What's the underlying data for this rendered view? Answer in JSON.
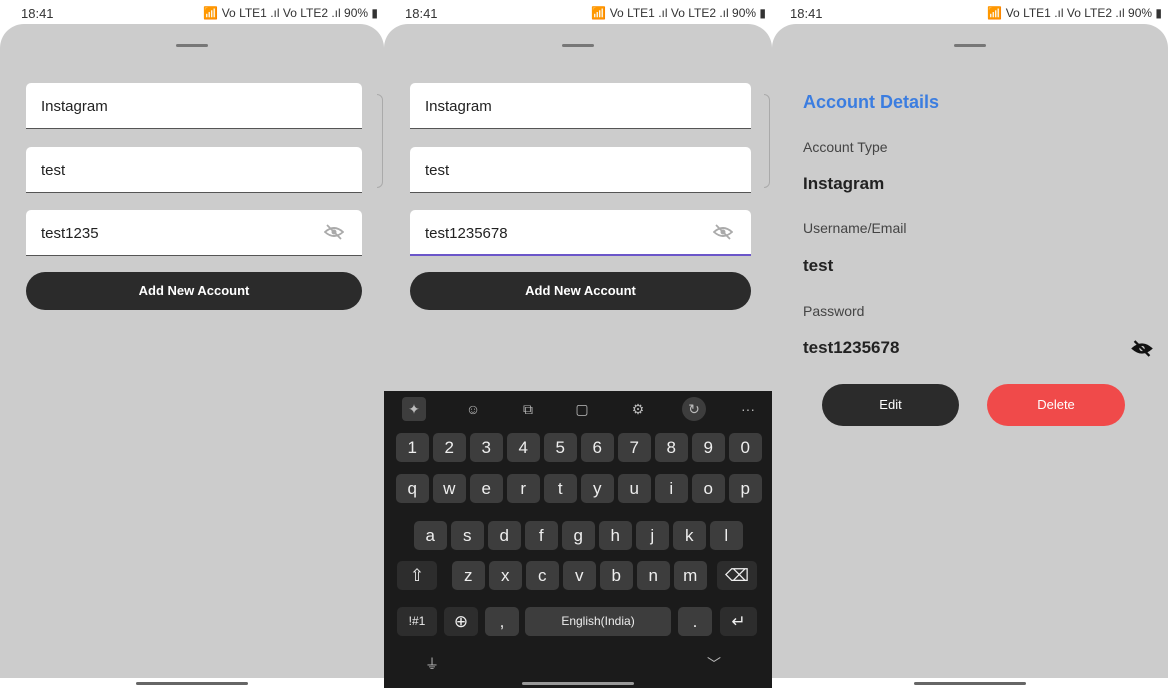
{
  "status": {
    "time": "18:41",
    "battery": "90%",
    "signal": "Vo LTE1 .ıl Vo LTE2 .ıl"
  },
  "screen1": {
    "account_type": "Instagram",
    "username": "test",
    "password": "test1235",
    "add_button": "Add New Account"
  },
  "screen2": {
    "account_type": "Instagram",
    "username": "test",
    "password": "test1235678",
    "add_button": "Add New Account",
    "keyboard": {
      "tools": [
        "sparkle-icon",
        "emoji-icon",
        "translate-icon",
        "clipboard-icon",
        "settings-icon",
        "mode-icon",
        "more-icon"
      ],
      "more": "···",
      "row_numbers": [
        "1",
        "2",
        "3",
        "4",
        "5",
        "6",
        "7",
        "8",
        "9",
        "0"
      ],
      "row1": [
        "q",
        "w",
        "e",
        "r",
        "t",
        "y",
        "u",
        "i",
        "o",
        "p"
      ],
      "row2": [
        "a",
        "s",
        "d",
        "f",
        "g",
        "h",
        "j",
        "k",
        "l"
      ],
      "row3": [
        "z",
        "x",
        "c",
        "v",
        "b",
        "n",
        "m"
      ],
      "shift": "⇧",
      "backspace": "⌫",
      "symbols": "!#1",
      "globe": "⊕",
      "comma": ",",
      "space": "English(India)",
      "period": ".",
      "enter": "↵",
      "mic": "🎙",
      "collapse": "﹀"
    }
  },
  "screen3": {
    "title": "Account Details",
    "account_type_label": "Account Type",
    "account_type_value": "Instagram",
    "username_label": "Username/Email",
    "username_value": "test",
    "password_label": "Password",
    "password_value": "test1235678",
    "edit_button": "Edit",
    "delete_button": "Delete",
    "colors": {
      "accent": "#3b7de0",
      "delete": "#f04a4a",
      "dark_button": "#2b2b2b"
    }
  }
}
